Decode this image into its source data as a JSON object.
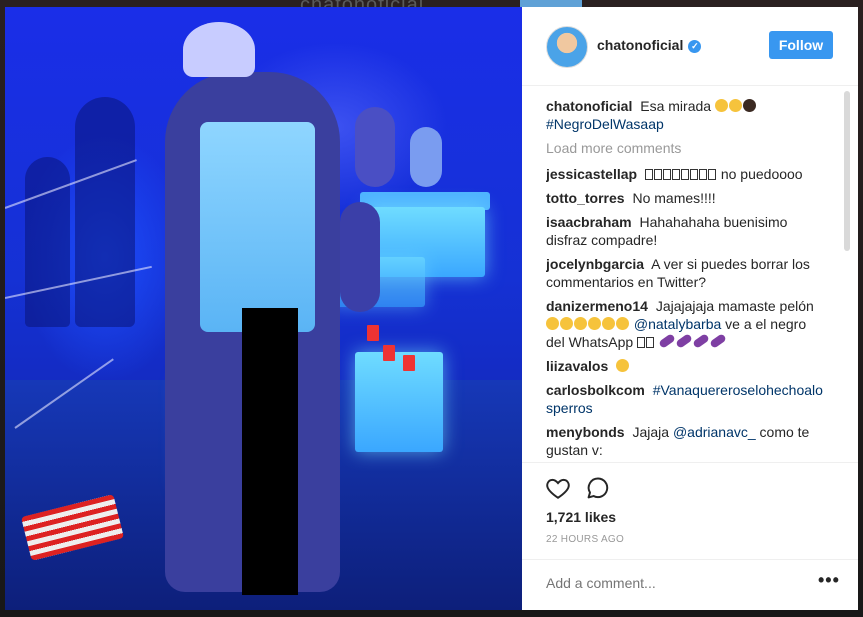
{
  "post": {
    "username": "chatonoficial",
    "follow_label": "Follow",
    "caption_text": "Esa mirada",
    "caption_hashtag": "#NegroDelWasaap",
    "load_more": "Load more comments",
    "likes": "1,721 likes",
    "time": "22 HOURS AGO",
    "add_comment_placeholder": "Add a comment...",
    "more_label": "•••"
  },
  "comments": [
    {
      "user": "jessicastellap",
      "text": "no puedoooo"
    },
    {
      "user": "totto_torres",
      "text": "No mames!!!!"
    },
    {
      "user": "isaacbraham",
      "text": "Hahahahaha buenisimo disfraz compadre!"
    },
    {
      "user": "jocelynbgarcia",
      "text": "A ver si puedes borrar los commentarios en Twitter?"
    },
    {
      "user": "danizermeno14",
      "text": "Jajajajaja mamaste pelón",
      "mention": "@natalybarba",
      "text2": "ve a el negro del WhatsApp"
    },
    {
      "user": "liizavalos",
      "text": ""
    },
    {
      "user": "carlosbolkcom",
      "hashtag": "#Vanaquereroselohechoalosperros"
    },
    {
      "user": "menybonds",
      "text": "Jajaja",
      "mention": "@adrianavc_",
      "text2": "como te gustan v:"
    }
  ],
  "backdrop": {
    "name": "chatonoficial"
  },
  "colors": {
    "accent": "#3897f0",
    "link": "#003569",
    "muted": "#999999"
  },
  "icons": [
    "verified-badge-icon",
    "heart-icon",
    "comment-icon",
    "more-options-icon"
  ]
}
